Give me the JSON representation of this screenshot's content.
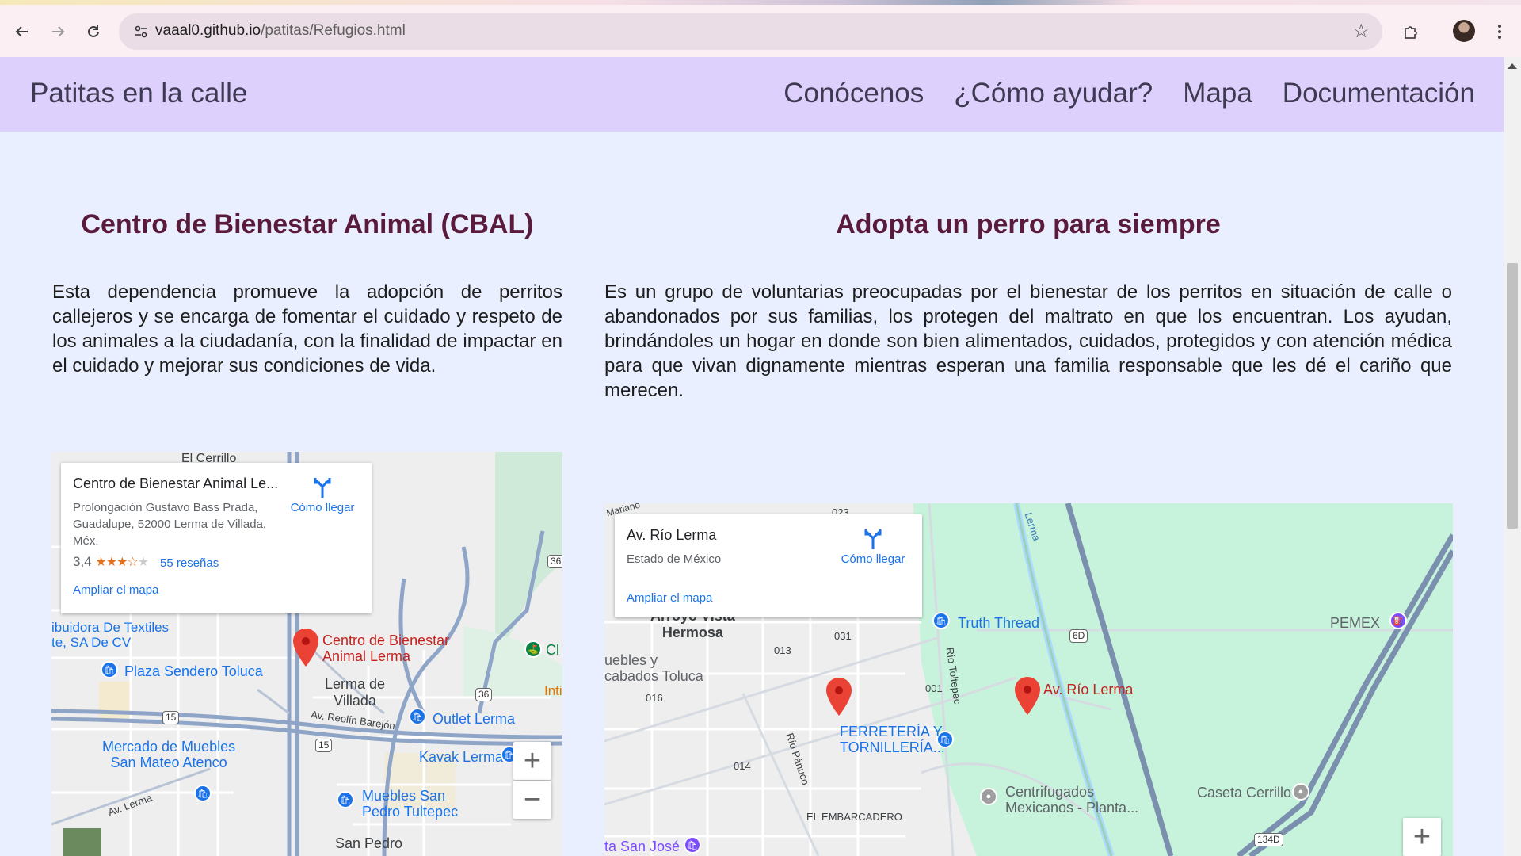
{
  "browser": {
    "url_host": "vaaal0.github.io",
    "url_path": "/patitas/Refugios.html",
    "back_icon": "arrow-left-icon",
    "forward_icon": "arrow-right-icon",
    "reload_icon": "reload-icon"
  },
  "site": {
    "brand": "Patitas en la calle",
    "nav": [
      "Conócenos",
      "¿Cómo ayudar?",
      "Mapa",
      "Documentación"
    ]
  },
  "left": {
    "title": "Centro de Bienestar Animal (CBAL)",
    "text": "Esta dependencia promueve la adopción de perritos callejeros y se encarga de fomentar el cuidado y respeto de los animales a la ciudadanía, con la finalidad de impactar en el cuidado y mejorar sus condiciones de vida.",
    "map": {
      "card_title": "Centro de Bienestar Animal Le...",
      "card_address": "Prolongación Gustavo Bass Prada, Guadalupe, 52000 Lerma de Villada, Méx.",
      "rating": "3,4",
      "reviews": "55 reseñas",
      "directions": "Cómo llegar",
      "enlarge": "Ampliar el mapa",
      "labels": {
        "cerrillo": "El Cerrillo",
        "textiles": "ibuidora De Textiles\nte, SA De CV",
        "plaza": "Plaza Sendero Toluca",
        "cbal_pin": "Centro de Bienestar\nAnimal Lerma",
        "lerma": "Lerma de\nVillada",
        "reolin": "Av. Reolín Barejón",
        "outlet": "Outlet Lerma",
        "kavak": "Kavak Lerma",
        "mercado": "Mercado de Muebles\nSan Mateo Atenco",
        "muebles": "Muebles San\nPedro Tultepec",
        "avlerma": "Av. Lerma",
        "sanpedro": "San Pedro",
        "inti": "Inti",
        "cl": "Cl"
      },
      "shields": [
        "36",
        "15",
        "15",
        "36"
      ]
    }
  },
  "right": {
    "title": "Adopta un perro para siempre",
    "text": "Es un grupo de voluntarias preocupadas por el bienestar de los perritos en situación de calle o abandonados por sus familias, los protegen del maltrato en que los encuentran. Los ayudan, brindándoles un hogar en donde son bien alimentados, cuidados, protegidos y con atención médica para que vivan dignamente mientras esperan una familia responsable que les dé el cariño que merecen.",
    "map": {
      "card_title": "Av. Río Lerma",
      "card_address": "Estado de México",
      "directions": "Cómo llegar",
      "enlarge": "Ampliar el mapa",
      "labels": {
        "mariano": "Mariano",
        "arroyo": "Arroyo Vista\nHermosa",
        "muebles": "uebles y\ncabados Toluca",
        "truth": "Truth Thread",
        "pemex": "PEMEX",
        "pin": "Av. Río Lerma",
        "ferreteria": "FERRETERÍA Y\nTORNILLERÍA...",
        "centrifugados": "Centrifugados\nMexicanos - Planta...",
        "caseta": "Caseta Cerrillo",
        "embarcadero": "EL EMBARCADERO",
        "panuco": "Río Pánuco",
        "toltepec": "Río Toltepec",
        "lerma_river": "Lerma",
        "sanjose": "ta San José",
        "n031": "031",
        "n013": "013",
        "n016": "016",
        "n014": "014",
        "n001": "001",
        "n023": "023"
      },
      "shields": [
        "6D",
        "134D"
      ]
    }
  },
  "map_zoom_in": "+",
  "map_zoom_out": "−"
}
